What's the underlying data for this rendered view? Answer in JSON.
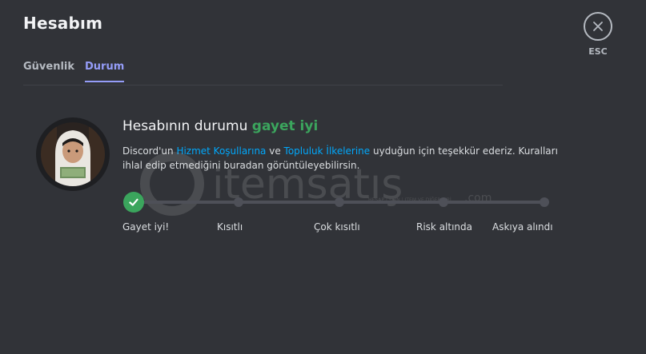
{
  "header": {
    "title": "Hesabım",
    "close_label": "ESC"
  },
  "tabs": [
    {
      "label": "Güvenlik",
      "active": false
    },
    {
      "label": "Durum",
      "active": true
    }
  ],
  "status": {
    "heading_prefix": "Hesabının durumu ",
    "heading_status": "gayet iyi",
    "desc_part1": "Discord'un ",
    "link_terms": "Hizmet Koşullarına",
    "desc_part2": " ve ",
    "link_guidelines": "Topluluk İlkelerine",
    "desc_part3": " uyduğun için teşekkür ederiz. Kuralları ihlal edip etmediğini buradan görüntüleyebilirsin.",
    "current_level": 0,
    "levels": [
      "Gayet iyi!",
      "Kısıtlı",
      "Çok kısıtlı",
      "Risk altında",
      "Askıya alındı"
    ]
  },
  "watermark": {
    "text": "itemsatış",
    "subtext": "HESAP | SKIN | ITEM VE DİĞERLERİ",
    "domain": ".com"
  },
  "colors": {
    "background": "#313338",
    "accent": "#949cf7",
    "success": "#3ba55d",
    "link": "#00a8fc",
    "track": "#4e5058"
  },
  "icons": {
    "close": "close-icon",
    "check": "check-icon",
    "avatar": "avatar"
  }
}
